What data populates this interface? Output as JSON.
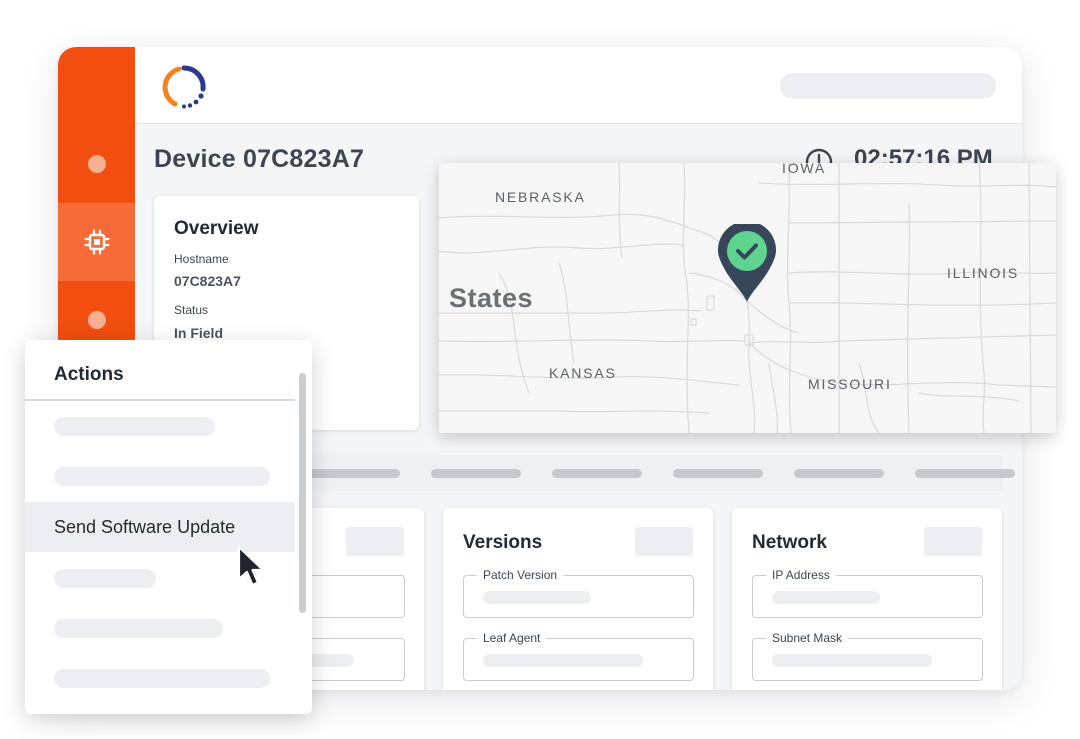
{
  "device": {
    "title": "Device 07C823A7"
  },
  "clock": {
    "time": "02:57:16 PM"
  },
  "overview": {
    "heading": "Overview",
    "hostname_label": "Hostname",
    "hostname_value": "07C823A7",
    "status_label": "Status",
    "status_value": "In Field"
  },
  "versions": {
    "heading": "Versions",
    "fields": [
      {
        "label": "Patch Version"
      },
      {
        "label": "Leaf Agent"
      }
    ]
  },
  "network": {
    "heading": "Network",
    "fields": [
      {
        "label": "IP Address"
      },
      {
        "label": "Subnet Mask"
      }
    ]
  },
  "map": {
    "labels": {
      "iowa": "IOWA",
      "nebraska": "NEBRASKA",
      "illinois": "ILLINOIS",
      "states": "States",
      "kansas": "KANSAS",
      "missouri": "MISSOURI"
    },
    "pin_status": "check-icon"
  },
  "actions": {
    "title": "Actions",
    "highlighted_item": "Send Software Update"
  },
  "colors": {
    "sidebar": "#f24e0f",
    "sidebar_active": "#f66b37",
    "pin_body": "#37465a",
    "pin_check": "#5fd48f",
    "logo_orange": "#f5821f",
    "logo_blue": "#2a3a8c"
  }
}
